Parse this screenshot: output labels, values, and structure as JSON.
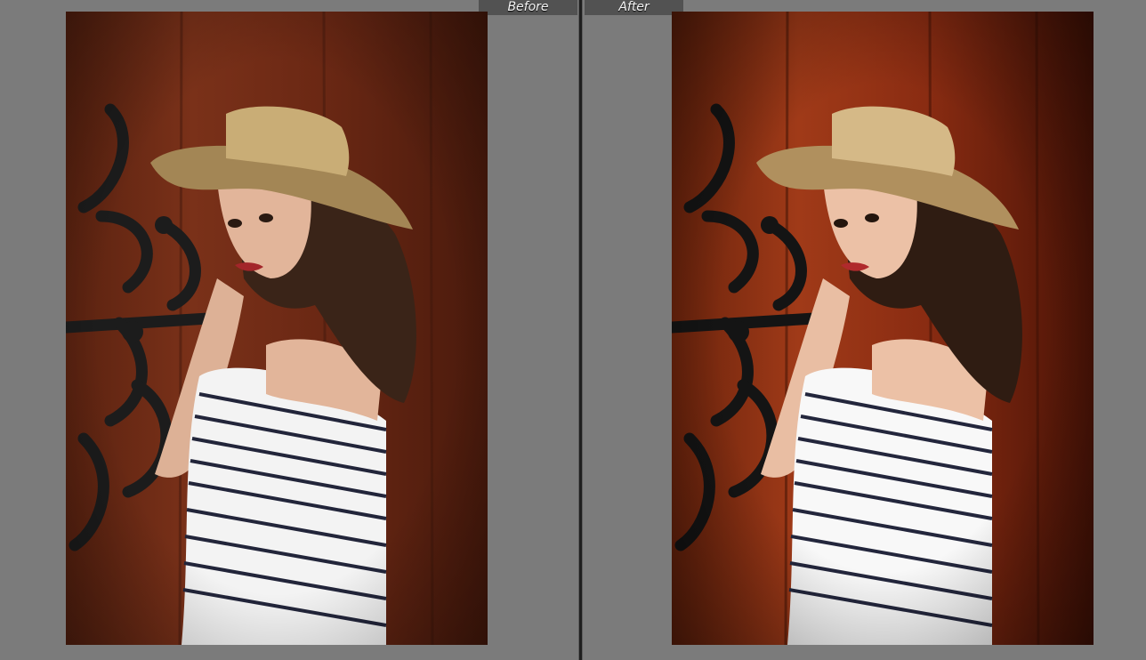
{
  "compare_view": {
    "before_label": "Before",
    "after_label": "After"
  },
  "photo": {
    "description_icon": "portrait-photo",
    "before_colors": {
      "background_wood": "#6e2a14",
      "wood_dark": "#4a1a0c",
      "hat": "#b89a63",
      "hair": "#3a2418",
      "skin": "#e2b59a",
      "shirt": "#f3f3f3",
      "stripes": "#22253a",
      "ironwork": "#1c1c1c"
    },
    "after_colors": {
      "background_wood": "#8a2c12",
      "wood_dark": "#521608",
      "hat": "#c3a271",
      "hair": "#2f1c12",
      "skin": "#ecc1a6",
      "shirt": "#f8f8f8",
      "stripes": "#23263c",
      "ironwork": "#141414"
    }
  }
}
